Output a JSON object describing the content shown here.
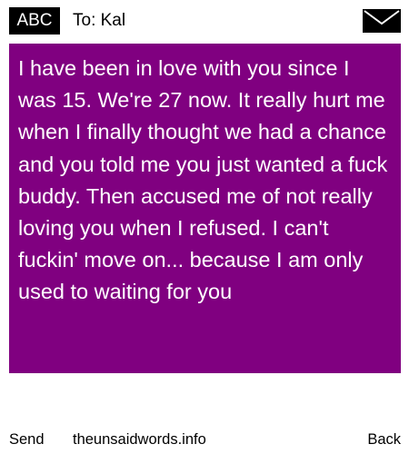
{
  "header": {
    "badge_label": "ABC",
    "recipient_label": "To: Kal",
    "envelope_icon": "envelope-icon"
  },
  "message": {
    "text": "I have been in love with you since I was 15. We're 27 now. It really hurt me when I finally thought we had a chance and you told me you just wanted a fuck buddy. Then accused me of not really loving you when I refused. I can't fuckin' move on... because I am only used to waiting for you",
    "background_color": "#800080",
    "text_color": "#ffffff"
  },
  "footer": {
    "send_label": "Send",
    "site_label": "theunsaidwords.info",
    "back_label": "Back"
  }
}
